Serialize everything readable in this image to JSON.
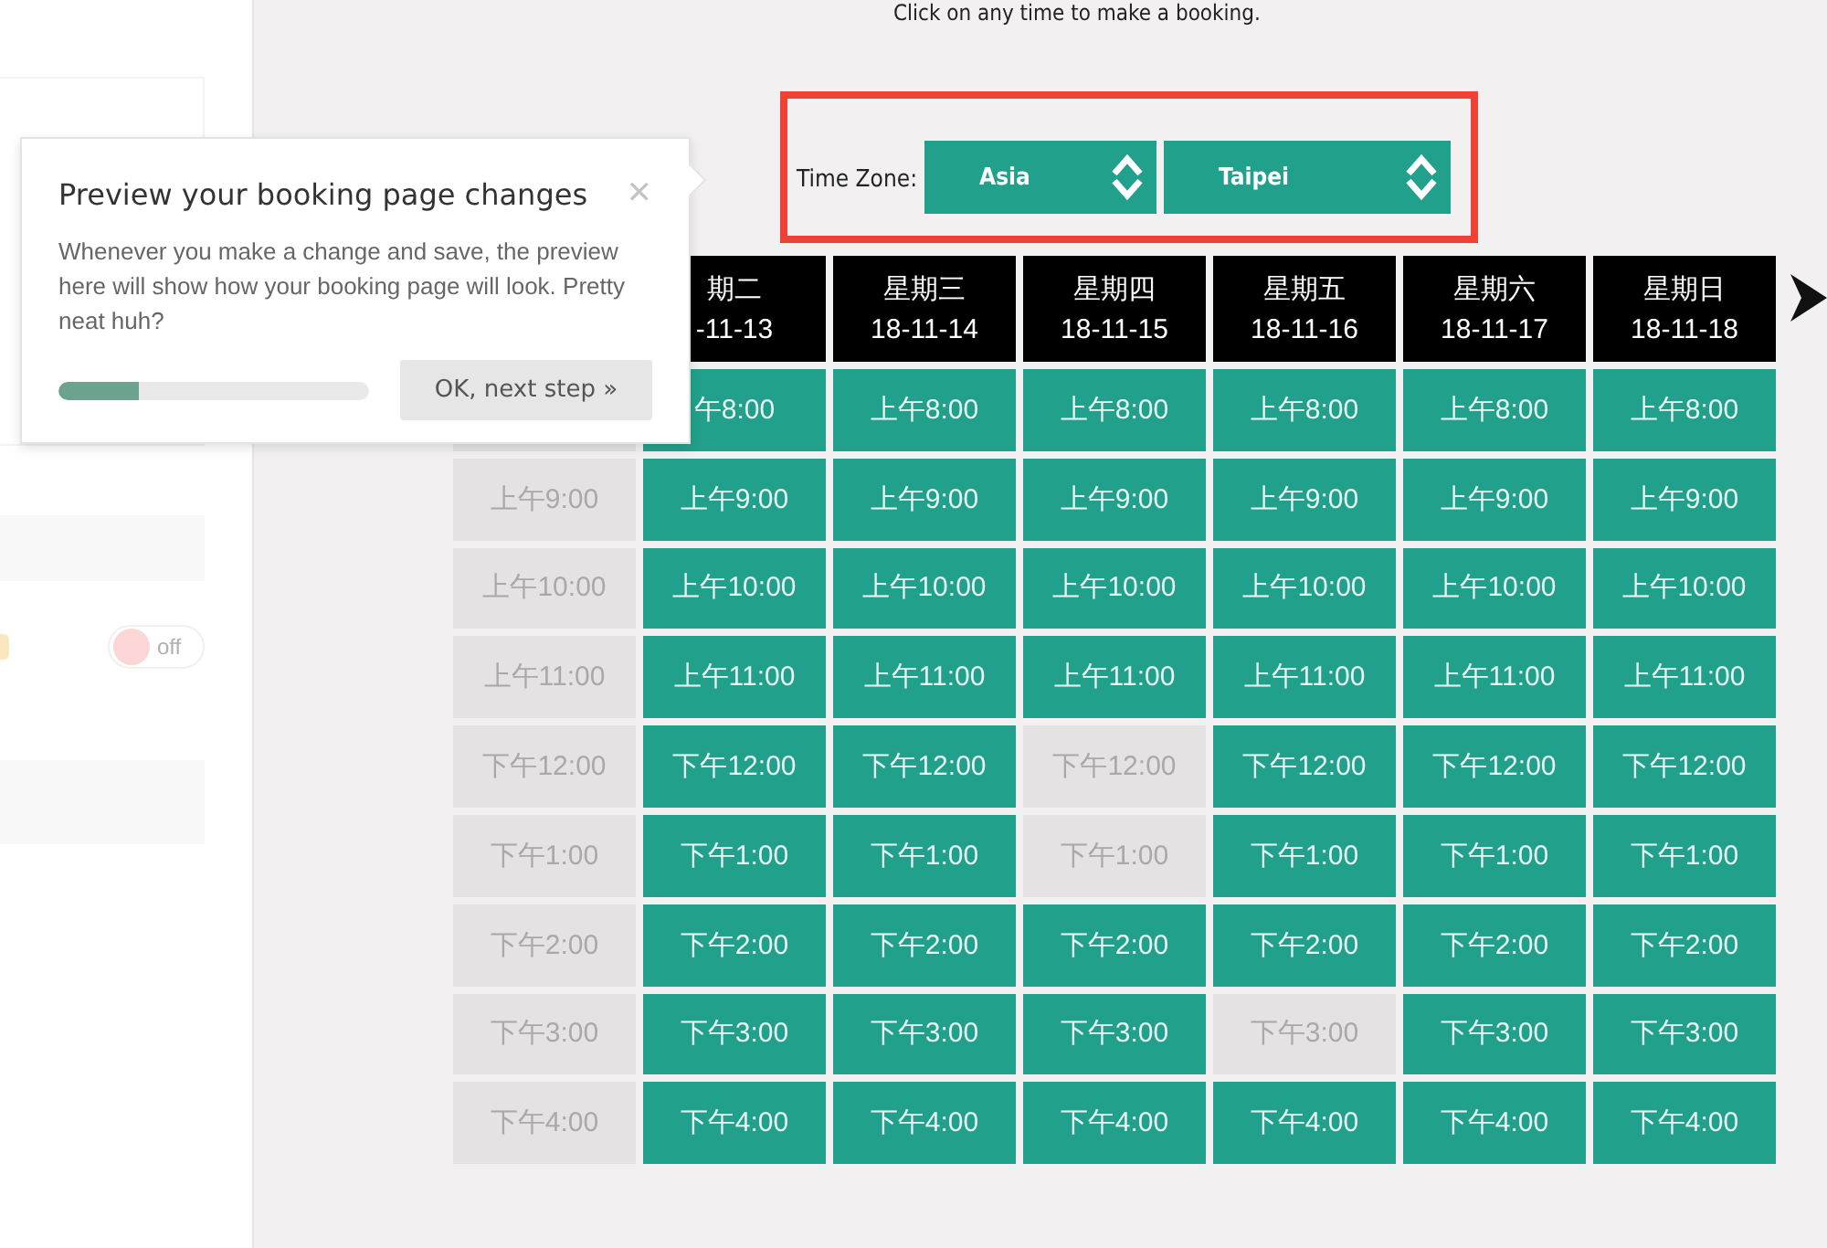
{
  "instruction": "Click on any time to make a booking.",
  "sidebar": {
    "toggle": {
      "label": "off",
      "on": false
    }
  },
  "time_zone": {
    "label": "Time Zone:",
    "region": "Asia",
    "city": "Taipei"
  },
  "calendar": {
    "columns": [
      {},
      {
        "day": "期二",
        "date": "-11-13"
      },
      {
        "day": "星期三",
        "date": "18-11-14"
      },
      {
        "day": "星期四",
        "date": "18-11-15"
      },
      {
        "day": "星期五",
        "date": "18-11-16"
      },
      {
        "day": "星期六",
        "date": "18-11-17"
      },
      {
        "day": "星期日",
        "date": "18-11-18"
      }
    ],
    "rows": [
      [
        {},
        {
          "time": "午8:00",
          "available": true
        },
        {
          "time": "上午8:00",
          "available": true
        },
        {
          "time": "上午8:00",
          "available": true
        },
        {
          "time": "上午8:00",
          "available": true
        },
        {
          "time": "上午8:00",
          "available": true
        },
        {
          "time": "上午8:00",
          "available": true
        }
      ],
      [
        {
          "time": "上午9:00",
          "available": false
        },
        {
          "time": "上午9:00",
          "available": true
        },
        {
          "time": "上午9:00",
          "available": true
        },
        {
          "time": "上午9:00",
          "available": true
        },
        {
          "time": "上午9:00",
          "available": true
        },
        {
          "time": "上午9:00",
          "available": true
        },
        {
          "time": "上午9:00",
          "available": true
        }
      ],
      [
        {
          "time": "上午10:00",
          "available": false
        },
        {
          "time": "上午10:00",
          "available": true
        },
        {
          "time": "上午10:00",
          "available": true
        },
        {
          "time": "上午10:00",
          "available": true
        },
        {
          "time": "上午10:00",
          "available": true
        },
        {
          "time": "上午10:00",
          "available": true
        },
        {
          "time": "上午10:00",
          "available": true
        }
      ],
      [
        {
          "time": "上午11:00",
          "available": false
        },
        {
          "time": "上午11:00",
          "available": true
        },
        {
          "time": "上午11:00",
          "available": true
        },
        {
          "time": "上午11:00",
          "available": true
        },
        {
          "time": "上午11:00",
          "available": true
        },
        {
          "time": "上午11:00",
          "available": true
        },
        {
          "time": "上午11:00",
          "available": true
        }
      ],
      [
        {
          "time": "下午12:00",
          "available": false
        },
        {
          "time": "下午12:00",
          "available": true
        },
        {
          "time": "下午12:00",
          "available": true
        },
        {
          "time": "下午12:00",
          "available": false
        },
        {
          "time": "下午12:00",
          "available": true
        },
        {
          "time": "下午12:00",
          "available": true
        },
        {
          "time": "下午12:00",
          "available": true
        }
      ],
      [
        {
          "time": "下午1:00",
          "available": false
        },
        {
          "time": "下午1:00",
          "available": true
        },
        {
          "time": "下午1:00",
          "available": true
        },
        {
          "time": "下午1:00",
          "available": false
        },
        {
          "time": "下午1:00",
          "available": true
        },
        {
          "time": "下午1:00",
          "available": true
        },
        {
          "time": "下午1:00",
          "available": true
        }
      ],
      [
        {
          "time": "下午2:00",
          "available": false
        },
        {
          "time": "下午2:00",
          "available": true
        },
        {
          "time": "下午2:00",
          "available": true
        },
        {
          "time": "下午2:00",
          "available": true
        },
        {
          "time": "下午2:00",
          "available": true
        },
        {
          "time": "下午2:00",
          "available": true
        },
        {
          "time": "下午2:00",
          "available": true
        }
      ],
      [
        {
          "time": "下午3:00",
          "available": false
        },
        {
          "time": "下午3:00",
          "available": true
        },
        {
          "time": "下午3:00",
          "available": true
        },
        {
          "time": "下午3:00",
          "available": true
        },
        {
          "time": "下午3:00",
          "available": false
        },
        {
          "time": "下午3:00",
          "available": true
        },
        {
          "time": "下午3:00",
          "available": true
        }
      ],
      [
        {
          "time": "下午4:00",
          "available": false
        },
        {
          "time": "下午4:00",
          "available": true
        },
        {
          "time": "下午4:00",
          "available": true
        },
        {
          "time": "下午4:00",
          "available": true
        },
        {
          "time": "下午4:00",
          "available": true
        },
        {
          "time": "下午4:00",
          "available": true
        },
        {
          "time": "下午4:00",
          "available": true
        }
      ]
    ]
  },
  "tour_popover": {
    "title": "Preview your booking page changes",
    "close": "✕",
    "body": "Whenever you make a change and save, the preview here will show how your booking page will look. Pretty neat huh?",
    "progress": {
      "level": 0.26
    },
    "button": "OK, next step »"
  }
}
